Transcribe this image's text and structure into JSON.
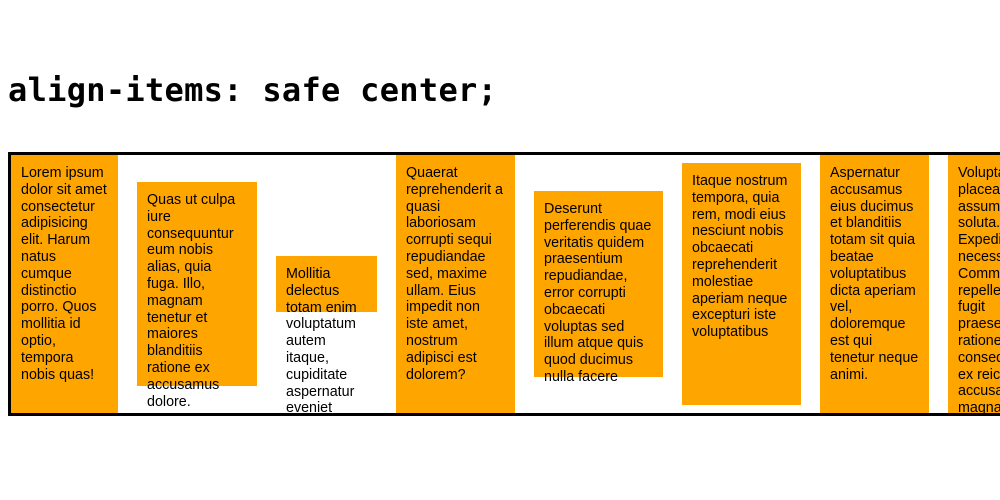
{
  "heading": "align-items: safe center;",
  "colors": {
    "item_background": "#ffa500",
    "container_border": "#000000"
  },
  "items": [
    {
      "text": "Lorem ipsum dolor sit amet consectetur adipisicing elit. Harum natus cumque distinctio porro. Quos mollitia id optio, tempora nobis quas!"
    },
    {
      "text": "Quas ut culpa iure consequuntur eum nobis alias, quia fuga. Illo, magnam tenetur et maiores blanditiis ratione ex accusamus dolore."
    },
    {
      "text": "Mollitia delectus totam enim voluptatum autem itaque, cupiditate aspernatur eveniet"
    },
    {
      "text": "Quaerat reprehenderit a quasi laboriosam corrupti sequi repudiandae sed, maxime ullam. Eius impedit non iste amet, nostrum adipisci est dolorem?"
    },
    {
      "text": "Deserunt perferendis quae veritatis quidem praesentium repudiandae, error corrupti obcaecati voluptas sed illum atque quis quod ducimus nulla facere"
    },
    {
      "text": "Itaque nostrum tempora, quia rem, modi eius nesciunt nobis obcaecati reprehenderit molestiae aperiam neque excepturi iste voluptatibus"
    },
    {
      "text": "Aspernatur accusamus eius ducimus et blanditiis totam sit quia beatae voluptatibus dicta aperiam vel, doloremque est qui tenetur neque animi."
    },
    {
      "text": "Voluptates placeat assumenda soluta. Expedita necessitatibus. Commodi repellendus fugit praesentium ratione consequatur ex reiciendis accusamus magnam"
    }
  ]
}
